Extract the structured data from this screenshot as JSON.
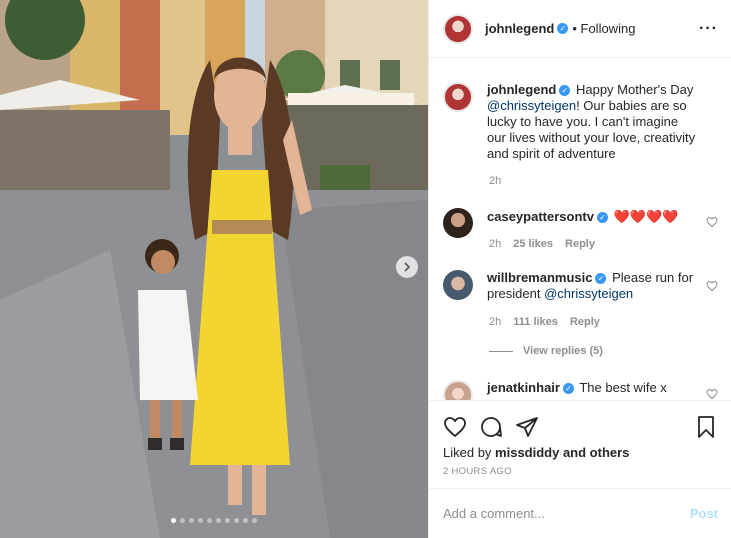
{
  "post": {
    "author": "johnlegend",
    "follow_status": "• Following",
    "more_icon": "more-icon",
    "caption": {
      "username": "johnlegend",
      "text_before": "Happy Mother's Day ",
      "mention": "@chrissyteigen",
      "text_after": "! Our babies are so lucky to have you. I can't imagine our lives without your love, creativity and spirit of adventure",
      "time": "2h"
    },
    "carousel": {
      "total": 10,
      "current": 1
    }
  },
  "comments": [
    {
      "username": "caseypattersontv",
      "text": "❤️❤️❤️❤️",
      "time": "2h",
      "likes": "25 likes",
      "reply": "Reply"
    },
    {
      "username": "willbremanmusic",
      "text_before": "Please run for president ",
      "mention": "@chrissyteigen",
      "time": "2h",
      "likes": "111 likes",
      "reply": "Reply",
      "view_replies": "View replies (5)"
    },
    {
      "username": "jenatkinhair",
      "text": "The best wife x"
    }
  ],
  "actions": {
    "liked_by": "Liked by ",
    "liked_by_user": "missdiddy",
    "liked_by_rest": " and others",
    "time_ago": "2 HOURS AGO"
  },
  "add_comment": {
    "placeholder": "Add a comment...",
    "post_label": "Post",
    "post_color": "#b2dffc"
  },
  "colors": {
    "verified": "#3897f0",
    "link": "#003569",
    "muted": "#8e8e8e"
  }
}
